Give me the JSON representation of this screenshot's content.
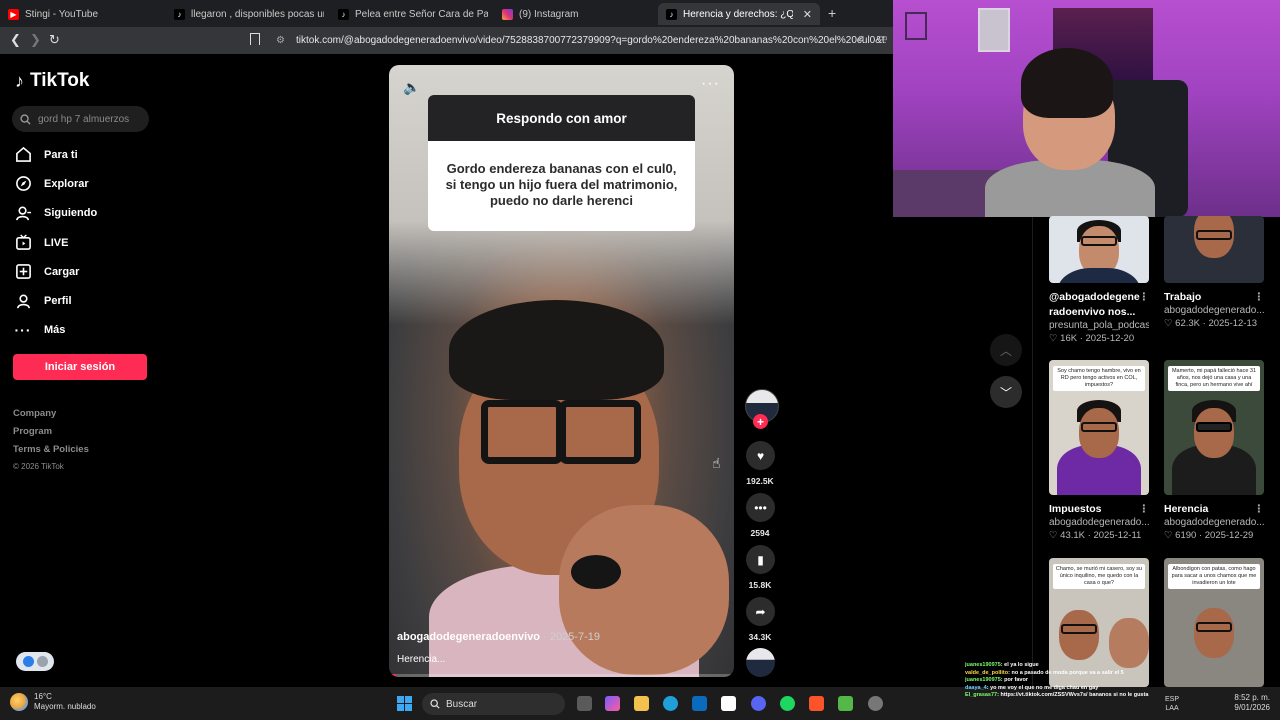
{
  "browser": {
    "tabs": [
      {
        "label": "Stingi - YouTube",
        "icon": "youtube-icon"
      },
      {
        "label": "llegaron , disponibles pocas unidade",
        "icon": "tiktok-icon"
      },
      {
        "label": "Pelea entre Señor Cara de Papa y Eri",
        "icon": "tiktok-icon"
      },
      {
        "label": "(9) Instagram",
        "icon": "instagram-icon"
      },
      {
        "label": "Herencia y derechos: ¿Qué pu",
        "icon": "tiktok-icon"
      }
    ],
    "url": "tiktok.com/@abogadodegeneradoenvivo/video/7528838700772379909?q=gordo%20endereza%20bananas%20con%20el%20cul0&t..."
  },
  "sidebar": {
    "logo": "TikTok",
    "search_placeholder": "gord hp 7 almuerzos",
    "nav": [
      {
        "label": "Para ti",
        "icon": "home-icon"
      },
      {
        "label": "Explorar",
        "icon": "compass-icon"
      },
      {
        "label": "Siguiendo",
        "icon": "following-icon"
      },
      {
        "label": "LIVE",
        "icon": "live-icon"
      },
      {
        "label": "Cargar",
        "icon": "upload-icon"
      },
      {
        "label": "Perfil",
        "icon": "profile-icon"
      },
      {
        "label": "Más",
        "icon": "more-icon"
      }
    ],
    "login_label": "Iniciar sesión",
    "footer": [
      "Company",
      "Program",
      "Terms & Policies"
    ],
    "copyright": "© 2026 TikTok"
  },
  "video": {
    "reply_header": "Respondo con amor",
    "reply_text": "Gordo endereza bananas con el cul0, si tengo un hijo fuera del matrimonio, puedo no darle herenci",
    "author": "abogadodegeneradoenvivo",
    "date": "2025-7-19",
    "description": "Herencia...",
    "progress": 0.02,
    "likes": "192.5K",
    "comments": "2594",
    "saves": "15.8K",
    "shares": "34.3K"
  },
  "feed": [
    {
      "title": "@abogadodegene",
      "title2": "radoenvivo nos...",
      "author": "presunta_pola_podcast",
      "likes": "16K",
      "date": "2025-12-20"
    },
    {
      "title": "Trabajo",
      "author": "abogadodegenerado...",
      "likes": "62.3K",
      "date": "2025-12-13"
    },
    {
      "title": "Impuestos",
      "author": "abogadodegenerado...",
      "likes": "43.1K",
      "date": "2025-12-11",
      "caption": "Soy chamo tengo hambre, vivo en RD pero tengo activos en COL, impuestos?"
    },
    {
      "title": "Herencia",
      "author": "abogadodegenerado...",
      "likes": "6190",
      "date": "2025-12-29",
      "caption": "Mamerto, mi papá falleció hace 31 años, nos dejó una casa y una finca, pero un hermano vive ahí"
    },
    {
      "caption": "Chamo, se murió mi casero, soy su único inquilino, me quedo con la casa o que?"
    },
    {
      "caption": "Albondigon con patas, como hago para sacar a unos chamos que me invadieron un lote"
    }
  ],
  "taskbar": {
    "temperature": "16°C",
    "weather": "Mayorm. nublado",
    "search_label": "Buscar",
    "lang1": "ESP",
    "lang2": "LAA",
    "time": "8:52 p. m.",
    "date": "9/01/2026"
  },
  "chat": [
    {
      "user": "juanes190975",
      "text": ": el ya lo sigue"
    },
    {
      "user": "valde_de_pollito",
      "text": ": no a pasado de moda porque va a salir el 5"
    },
    {
      "user": "juanes190975",
      "text": ": por favor"
    },
    {
      "user": "daaya_4",
      "text": ": yo me voy el que no me diga chau en gay"
    },
    {
      "user": "El_grasas77",
      "text": ": https://vt.tiktok.com/ZSSVWvs7s/ bananos si no le gusta"
    }
  ],
  "colors": {
    "brand": "#fe2c55",
    "background": "#000000"
  }
}
